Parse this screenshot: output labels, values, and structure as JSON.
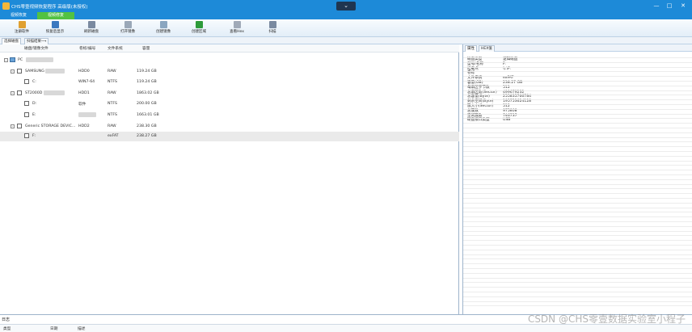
{
  "window": {
    "title": "CHS零壹视频恢复程序 高级版(未授权)",
    "collapse_glyph": "⌄",
    "min_glyph": "—",
    "max_glyph": "□",
    "close_glyph": "✕"
  },
  "tabs": [
    "视频恢复",
    "视频修复"
  ],
  "toolbar": [
    {
      "label": "注册软件",
      "icon": "key-icon",
      "color": "#e0a030"
    },
    {
      "label": "恢复后显示",
      "icon": "monitor-icon",
      "color": "#3a78c0"
    },
    {
      "label": "刷新磁盘",
      "icon": "refresh-disk-icon",
      "color": "#7a8aa0"
    },
    {
      "label": "打开镜像",
      "icon": "open-image-icon",
      "color": "#9aa8b8"
    },
    {
      "label": "创建镜像",
      "icon": "create-image-icon",
      "color": "#8aa6c0"
    },
    {
      "label": "创建区域",
      "icon": "create-region-icon",
      "color": "#2e9b3a"
    },
    {
      "label": "查看Hex",
      "icon": "hex-view-icon",
      "color": "#a0aab8"
    },
    {
      "label": "扫描",
      "icon": "scan-icon",
      "color": "#7a8aa0"
    }
  ],
  "subtabs": [
    "选择磁盘",
    "扫描结果"
  ],
  "subtab_arrow": "⟶",
  "table": {
    "headers": [
      "磁盘/镜像文件",
      "卷标/编号",
      "文件系统",
      "容量"
    ],
    "rows": [
      {
        "name": "PC",
        "label": "",
        "fs": "",
        "size": ""
      },
      {
        "name": "SAMSUNG",
        "label": "HDD0",
        "fs": "RAW",
        "size": "119.24 GB"
      },
      {
        "name": "C:",
        "label": "WIN7-64",
        "fs": "NTFS",
        "size": "119.24 GB"
      },
      {
        "name": "ST2000D",
        "label": "HDD1",
        "fs": "RAW",
        "size": "1863.02 GB"
      },
      {
        "name": "D:",
        "label": "软件",
        "fs": "NTFS",
        "size": "200.00 GB"
      },
      {
        "name": "E:",
        "label": "",
        "fs": "NTFS",
        "size": "1663.01 GB"
      },
      {
        "name": "Generic STORAGE DEVIC...",
        "label": "HDD2",
        "fs": "RAW",
        "size": "238.30 GB"
      },
      {
        "name": "F:",
        "label": "",
        "fs": "exFAT",
        "size": "238.27 GB"
      }
    ]
  },
  "right_tabs": [
    "属性",
    "HEX值"
  ],
  "properties": [
    {
      "k": "磁盘类型",
      "v": "逻辑磁盘"
    },
    {
      "k": "型号/名称",
      "v": "F:"
    },
    {
      "k": "挂载点",
      "v": "\\\\.\\F:"
    },
    {
      "k": "卷标",
      "v": ""
    },
    {
      "k": "文件系统",
      "v": "exFAT"
    },
    {
      "k": "容量(GB)",
      "v": "238.27 GB"
    },
    {
      "k": "每扇区字节数",
      "v": "512"
    },
    {
      "k": "总扇区数(Sector)",
      "v": "499679232"
    },
    {
      "k": "总容量(Byte)",
      "v": "255835766784"
    },
    {
      "k": "剩余空间(Byte)",
      "v": "195753624128"
    },
    {
      "k": "簇大小(Sector)",
      "v": "512"
    },
    {
      "k": "总簇数",
      "v": "975808"
    },
    {
      "k": "空闲簇数",
      "v": "746737"
    },
    {
      "k": "硬盘接口类型",
      "v": "USB"
    }
  ],
  "log": {
    "title": "日志",
    "headers": [
      "类型",
      "日期",
      "描述"
    ]
  },
  "watermark": "CSDN @CHS零壹数据实验室小程子"
}
